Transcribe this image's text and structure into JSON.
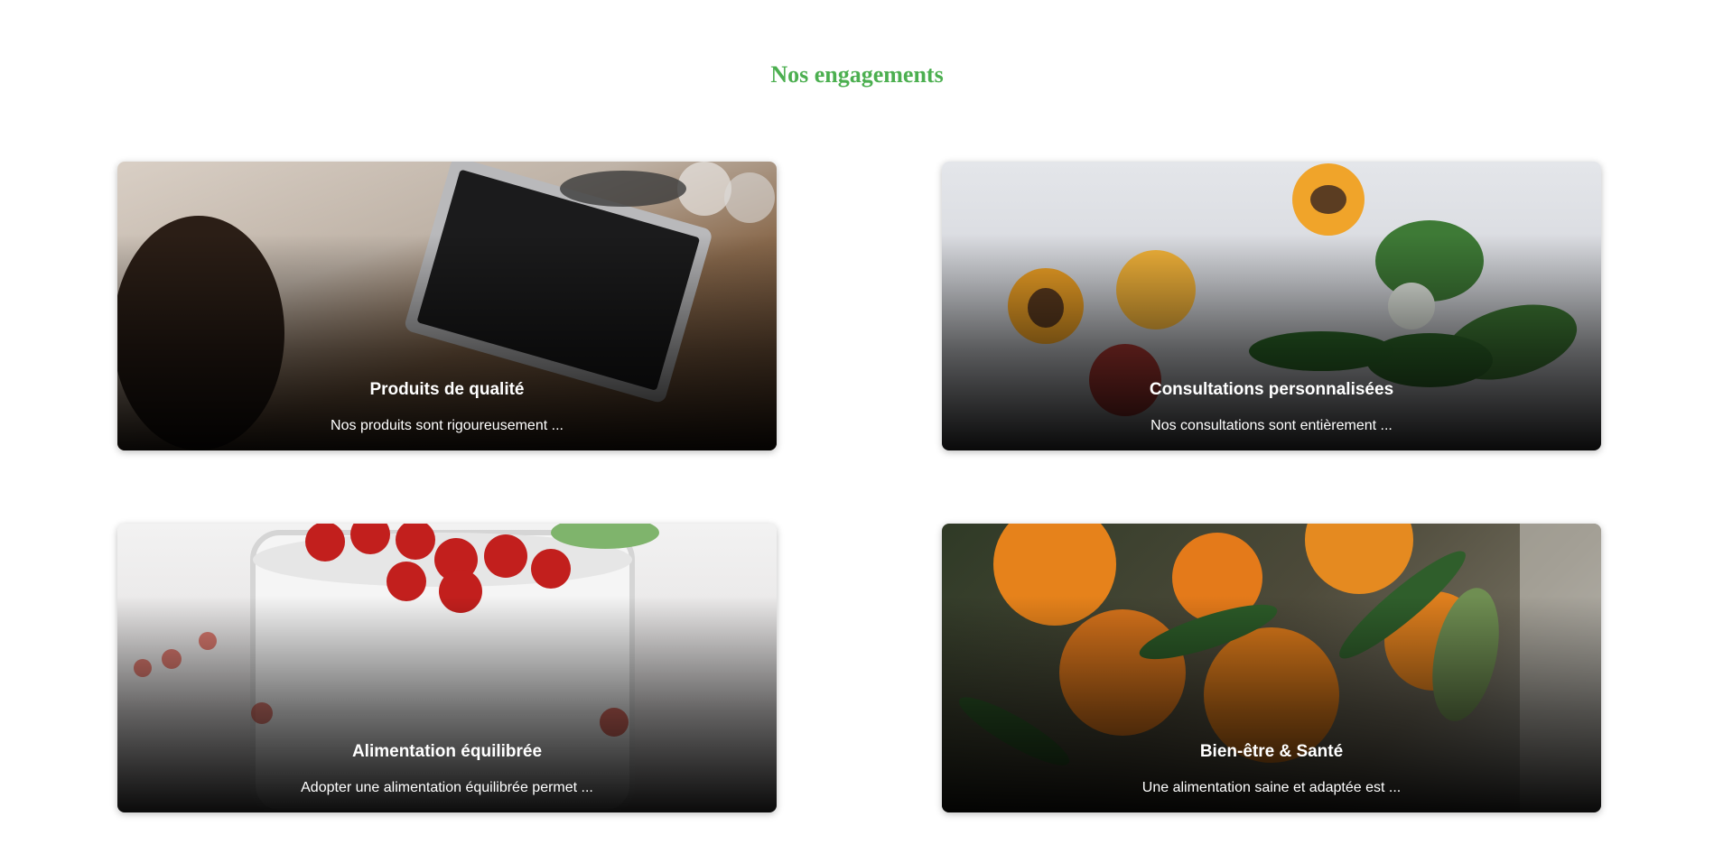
{
  "section": {
    "title": "Nos engagements"
  },
  "cards": [
    {
      "title": "Produits de qualité",
      "description": "Nos produits sont rigoureusement ...",
      "image": "laptop-table-photo"
    },
    {
      "title": "Consultations personnalisées",
      "description": "Nos consultations sont entièrement ...",
      "image": "apricots-leaves-photo"
    },
    {
      "title": "Alimentation équilibrée",
      "description": "Adopter une alimentation équilibrée permet ...",
      "image": "berry-jar-photo"
    },
    {
      "title": "Bien-être & Santé",
      "description": "Une alimentation saine et adaptée est ...",
      "image": "oranges-leaves-photo"
    }
  ],
  "colors": {
    "accent": "#4caf50",
    "card_text": "#ffffff"
  }
}
